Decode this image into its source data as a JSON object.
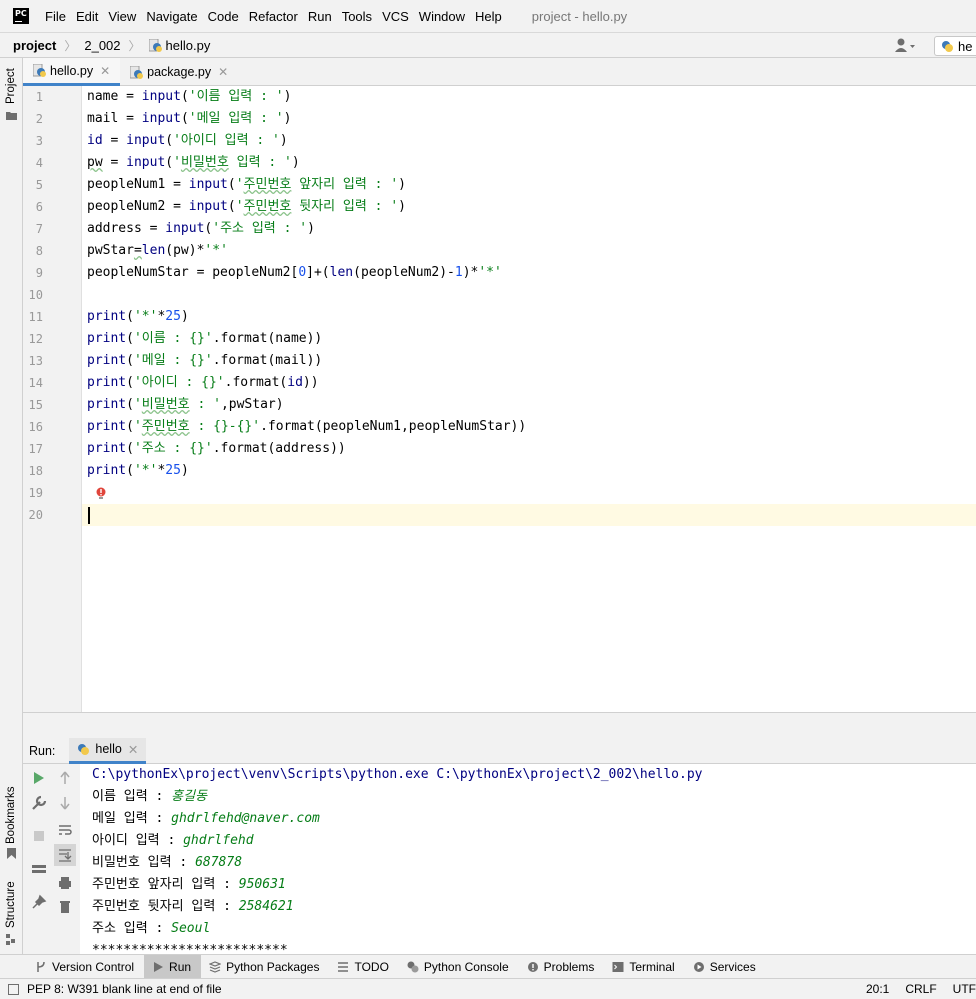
{
  "menubar": {
    "items": [
      "File",
      "Edit",
      "View",
      "Navigate",
      "Code",
      "Refactor",
      "Run",
      "Tools",
      "VCS",
      "Window",
      "Help"
    ],
    "window_title": "project - hello.py"
  },
  "navbar": {
    "project": "project",
    "folder": "2_002",
    "file": "hello.py",
    "run_config": "he"
  },
  "sidebar": {
    "project_tab": "Project",
    "bookmarks_tab": "Bookmarks",
    "structure_tab": "Structure"
  },
  "editor": {
    "tabs": [
      {
        "label": "hello.py",
        "active": true
      },
      {
        "label": "package.py",
        "active": false
      }
    ],
    "line_numbers": [
      "1",
      "2",
      "3",
      "4",
      "5",
      "6",
      "7",
      "8",
      "9",
      "10",
      "11",
      "12",
      "13",
      "14",
      "15",
      "16",
      "17",
      "18",
      "19",
      "20"
    ]
  },
  "run_panel": {
    "label": "Run:",
    "tab": "hello",
    "command": "C:\\pythonEx\\project\\venv\\Scripts\\python.exe C:\\pythonEx\\project\\2_002\\hello.py",
    "output": [
      {
        "prompt": "이름 입력 : ",
        "input": "홍길동"
      },
      {
        "prompt": "메일 입력 : ",
        "input": "ghdrlfehd@naver.com"
      },
      {
        "prompt": "아이디 입력 : ",
        "input": "ghdrlfehd"
      },
      {
        "prompt": "비밀번호 입력 : ",
        "input": "687878"
      },
      {
        "prompt": "주민번호 앞자리 입력 : ",
        "input": "950631"
      },
      {
        "prompt": "주민번호 뒷자리 입력 : ",
        "input": "2584621"
      },
      {
        "prompt": "주소 입력 : ",
        "input": "Seoul"
      }
    ],
    "stars": "*************************"
  },
  "tool_windows": [
    {
      "label": "Version Control",
      "icon": "branch-icon"
    },
    {
      "label": "Run",
      "icon": "run-icon",
      "active": true
    },
    {
      "label": "Python Packages",
      "icon": "packages-icon"
    },
    {
      "label": "TODO",
      "icon": "todo-icon"
    },
    {
      "label": "Python Console",
      "icon": "python-console-icon"
    },
    {
      "label": "Problems",
      "icon": "problems-icon"
    },
    {
      "label": "Terminal",
      "icon": "terminal-icon"
    },
    {
      "label": "Services",
      "icon": "services-icon"
    }
  ],
  "status": {
    "message": "PEP 8: W391 blank line at end of file",
    "position": "20:1",
    "line_sep": "CRLF",
    "encoding": "UTF"
  },
  "colors": {
    "keyword": "#000080",
    "string": "#067d17",
    "number": "#1750eb",
    "accent": "#4083c9"
  }
}
